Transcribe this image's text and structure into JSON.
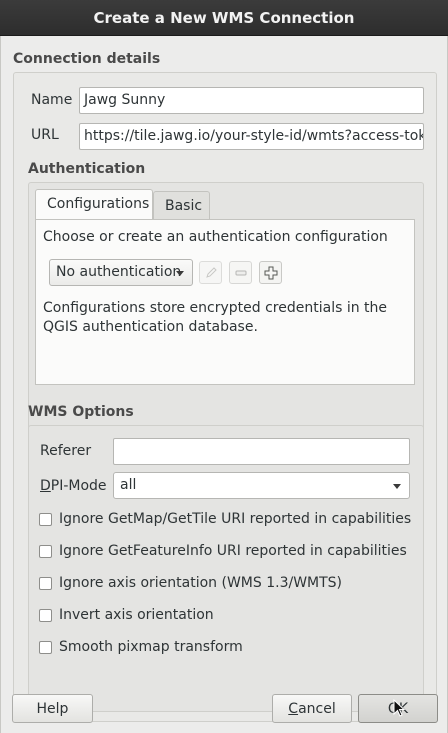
{
  "window": {
    "title": "Create a New WMS Connection"
  },
  "connection": {
    "section_title": "Connection details",
    "name_label": "Name",
    "name_value": "Jawg Sunny",
    "url_label": "URL",
    "url_value": "https://tile.jawg.io/your-style-id/wmts?access-token"
  },
  "authentication": {
    "section_title": "Authentication",
    "tabs": [
      {
        "label": "Configurations",
        "active": true
      },
      {
        "label": "Basic",
        "active": false
      }
    ],
    "instruction": "Choose or create an authentication configuration",
    "config_select_value": "No authentication",
    "description": "Configurations store encrypted credentials in the QGIS authentication database.",
    "icons": [
      "edit-icon",
      "remove-icon",
      "add-icon"
    ]
  },
  "wms_options": {
    "section_title": "WMS Options",
    "referer_label": "Referer",
    "referer_value": "",
    "dpi_label_mnemonic": "D",
    "dpi_label_rest": "PI-Mode",
    "dpi_value": "all",
    "checkboxes": [
      {
        "label": "Ignore GetMap/GetTile URI reported in capabilities",
        "checked": false
      },
      {
        "label": "Ignore GetFeatureInfo URI reported in capabilities",
        "checked": false
      },
      {
        "label": "Ignore axis orientation (WMS 1.3/WMTS)",
        "checked": false
      },
      {
        "label": "Invert axis orientation",
        "checked": false
      },
      {
        "label": "Smooth pixmap transform",
        "checked": false
      }
    ]
  },
  "buttons": {
    "help": "Help",
    "cancel_mnemonic": "C",
    "cancel_rest": "ancel",
    "ok_label": "OK"
  }
}
